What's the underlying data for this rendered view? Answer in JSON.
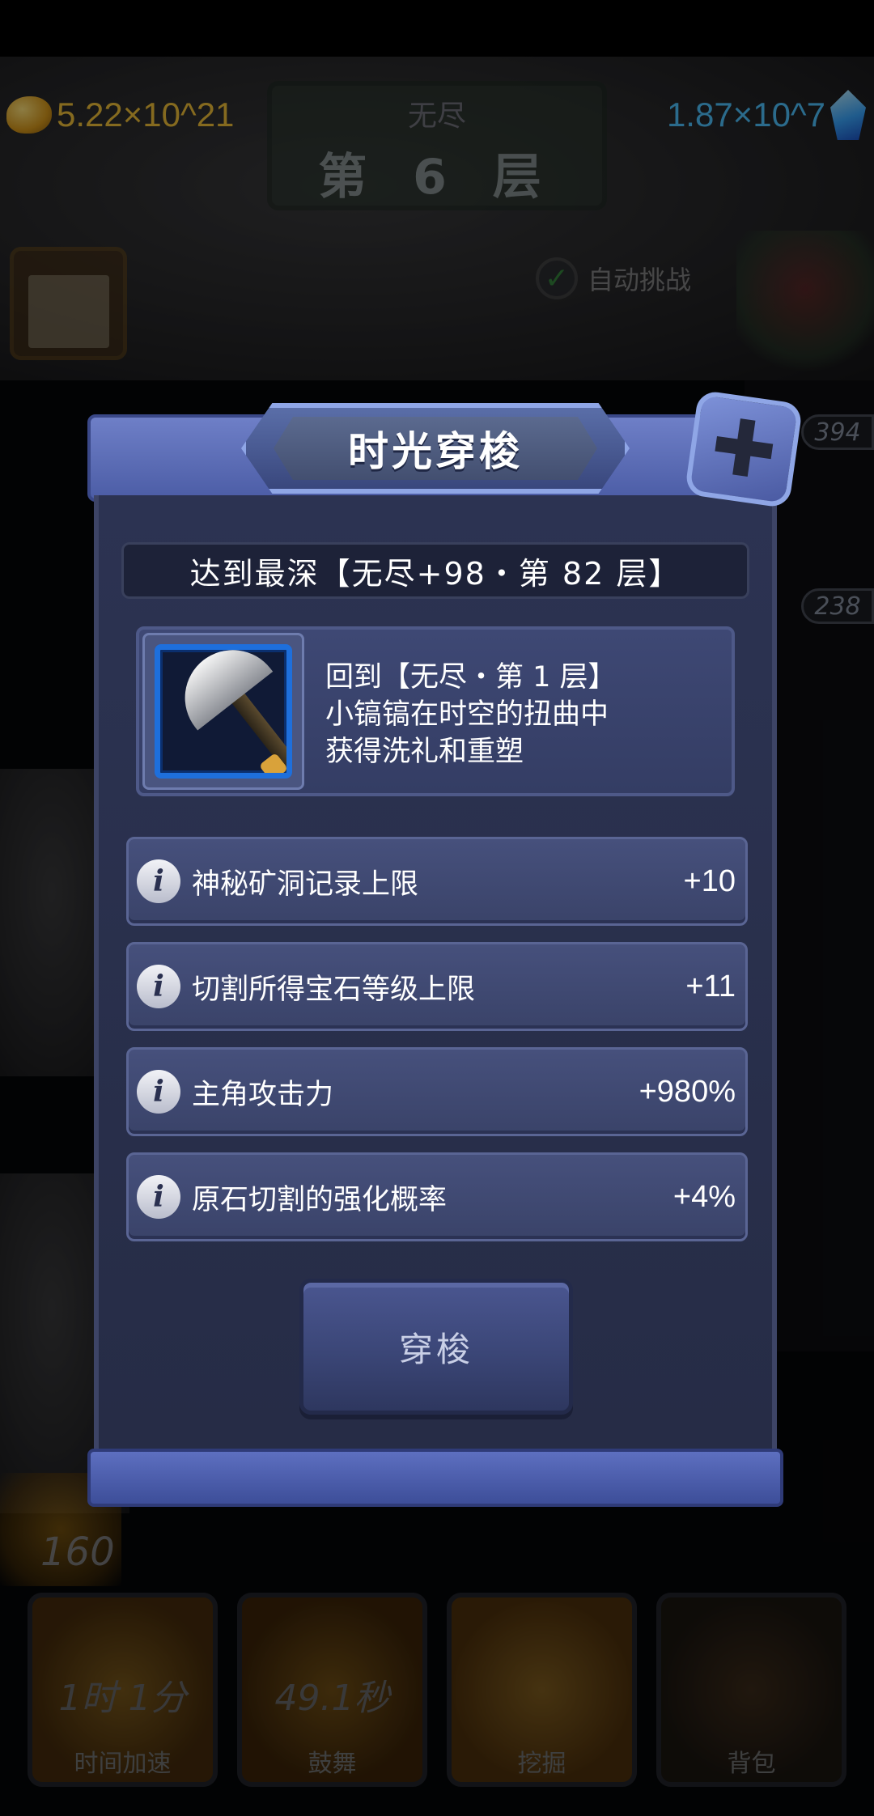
{
  "currency": {
    "gold_value": "5.22×10^21",
    "gem_value": "1.87×10^7"
  },
  "level_sign": {
    "mode": "无尽",
    "floor": "第 6 层"
  },
  "auto_fight": {
    "label": "自动挑战",
    "checked": true
  },
  "side_badges": [
    "394",
    "238"
  ],
  "hero_count": "160",
  "skills": [
    {
      "timer": "1时 1分",
      "name": "时间加速"
    },
    {
      "timer": "49.1秒",
      "name": "鼓舞"
    },
    {
      "timer": "",
      "name": "挖掘"
    },
    {
      "timer": "",
      "name": "背包"
    }
  ],
  "modal": {
    "title": "时光穿梭",
    "close_symbol": "✚",
    "reached": "达到最深【无尽+98・第 82 层】",
    "item_desc_lines": [
      "回到【无尽・第 1 层】",
      "小镐镐在时空的扭曲中",
      "获得洗礼和重塑"
    ],
    "stats": [
      {
        "label": "神秘矿洞记录上限",
        "value": "+10"
      },
      {
        "label": "切割所得宝石等级上限",
        "value": "+11"
      },
      {
        "label": "主角攻击力",
        "value": "+980%"
      },
      {
        "label": "原石切割的强化概率",
        "value": "+4%"
      }
    ],
    "info_glyph": "i",
    "travel_button": "穿梭"
  },
  "colors": {
    "gold_text": "#f2c23a",
    "gem_text": "#4fc3ff",
    "modal_header": "#5d6fc0",
    "item_frame_border": "#1e6fdc"
  }
}
